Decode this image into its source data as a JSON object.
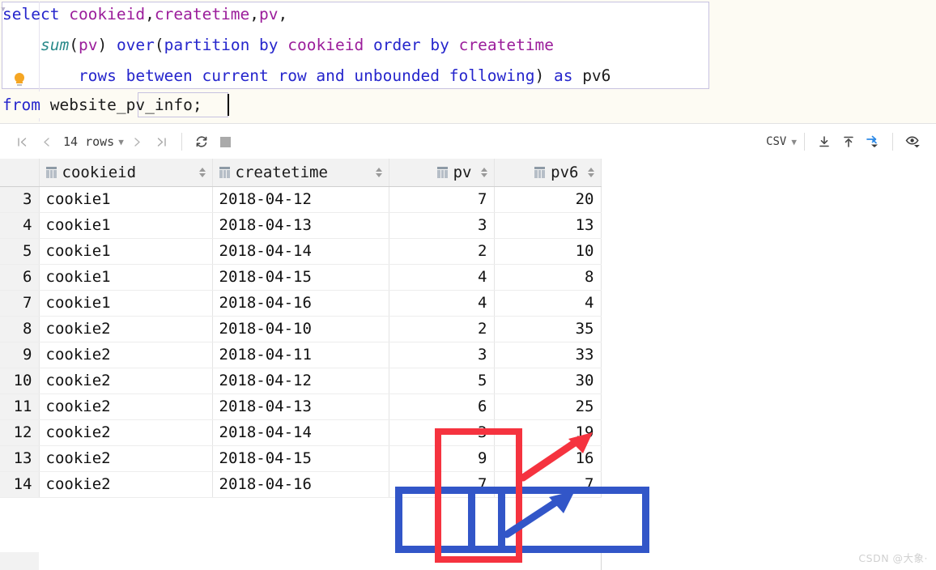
{
  "editor": {
    "lines": [
      {
        "indent": 0,
        "tokens": [
          {
            "t": "select",
            "c": "kw"
          },
          {
            "t": " ",
            "c": "plain"
          },
          {
            "t": "cookieid",
            "c": "ident"
          },
          {
            "t": ",",
            "c": "punct"
          },
          {
            "t": "createtime",
            "c": "ident"
          },
          {
            "t": ",",
            "c": "punct"
          },
          {
            "t": "pv",
            "c": "ident"
          },
          {
            "t": ",",
            "c": "punct"
          }
        ]
      },
      {
        "indent": 4,
        "tokens": [
          {
            "t": "sum",
            "c": "fn"
          },
          {
            "t": "(",
            "c": "punct"
          },
          {
            "t": "pv",
            "c": "ident"
          },
          {
            "t": ")",
            "c": "punct"
          },
          {
            "t": " ",
            "c": "plain"
          },
          {
            "t": "over",
            "c": "kw"
          },
          {
            "t": "(",
            "c": "punct"
          },
          {
            "t": "partition by",
            "c": "kw"
          },
          {
            "t": " ",
            "c": "plain"
          },
          {
            "t": "cookieid",
            "c": "ident"
          },
          {
            "t": " ",
            "c": "plain"
          },
          {
            "t": "order by",
            "c": "kw"
          },
          {
            "t": " ",
            "c": "plain"
          },
          {
            "t": "createtime",
            "c": "ident"
          }
        ]
      },
      {
        "indent": 8,
        "tokens": [
          {
            "t": "rows between current row and unbounded following",
            "c": "kw"
          },
          {
            "t": ")",
            "c": "punct"
          },
          {
            "t": " ",
            "c": "plain"
          },
          {
            "t": "as",
            "c": "kw"
          },
          {
            "t": " ",
            "c": "plain"
          },
          {
            "t": "pv6",
            "c": "plain"
          }
        ]
      },
      {
        "indent": 0,
        "tokens": [
          {
            "t": "from",
            "c": "kw"
          },
          {
            "t": " ",
            "c": "plain"
          },
          {
            "t": "website_pv_info",
            "c": "plain"
          },
          {
            "t": ";",
            "c": "punct"
          }
        ]
      }
    ],
    "full_sql": "select cookieid,createtime,pv,\n    sum(pv) over(partition by cookieid order by createtime\n        rows between current row and unbounded following) as pv6\nfrom website_pv_info;",
    "bulb_icon": "lightbulb-icon"
  },
  "toolbar": {
    "first_page_icon": "first-page-icon",
    "prev_page_icon": "prev-page-icon",
    "rows_label": "14 rows",
    "rows_chevron": "chevron-down-icon",
    "next_page_icon": "next-page-icon",
    "last_page_icon": "last-page-icon",
    "reload_icon": "refresh-icon",
    "stop_icon": "stop-icon",
    "format_label": "CSV",
    "format_chevron": "chevron-down-icon",
    "download_icon": "download-icon",
    "upload_icon": "upload-icon",
    "compare_icon": "transpose-icon",
    "view_icon": "eye-icon"
  },
  "table": {
    "columns": [
      {
        "key": "rownum",
        "label": "",
        "icon": "",
        "sortable": false
      },
      {
        "key": "cookieid",
        "label": "cookieid",
        "icon": "column-icon",
        "sortable": true
      },
      {
        "key": "createtime",
        "label": "createtime",
        "icon": "column-icon",
        "sortable": true
      },
      {
        "key": "pv",
        "label": "pv",
        "icon": "column-icon",
        "sortable": true
      },
      {
        "key": "pv6",
        "label": "pv6",
        "icon": "column-icon",
        "sortable": true
      }
    ],
    "rows": [
      {
        "n": "3",
        "cookieid": "cookie1",
        "createtime": "2018-04-12",
        "pv": "7",
        "pv6": "20"
      },
      {
        "n": "4",
        "cookieid": "cookie1",
        "createtime": "2018-04-13",
        "pv": "3",
        "pv6": "13"
      },
      {
        "n": "5",
        "cookieid": "cookie1",
        "createtime": "2018-04-14",
        "pv": "2",
        "pv6": "10"
      },
      {
        "n": "6",
        "cookieid": "cookie1",
        "createtime": "2018-04-15",
        "pv": "4",
        "pv6": "8"
      },
      {
        "n": "7",
        "cookieid": "cookie1",
        "createtime": "2018-04-16",
        "pv": "4",
        "pv6": "4"
      },
      {
        "n": "8",
        "cookieid": "cookie2",
        "createtime": "2018-04-10",
        "pv": "2",
        "pv6": "35"
      },
      {
        "n": "9",
        "cookieid": "cookie2",
        "createtime": "2018-04-11",
        "pv": "3",
        "pv6": "33"
      },
      {
        "n": "10",
        "cookieid": "cookie2",
        "createtime": "2018-04-12",
        "pv": "5",
        "pv6": "30"
      },
      {
        "n": "11",
        "cookieid": "cookie2",
        "createtime": "2018-04-13",
        "pv": "6",
        "pv6": "25"
      },
      {
        "n": "12",
        "cookieid": "cookie2",
        "createtime": "2018-04-14",
        "pv": "3",
        "pv6": "19"
      },
      {
        "n": "13",
        "cookieid": "cookie2",
        "createtime": "2018-04-15",
        "pv": "9",
        "pv6": "16"
      },
      {
        "n": "14",
        "cookieid": "cookie2",
        "createtime": "2018-04-16",
        "pv": "7",
        "pv6": "7"
      }
    ]
  },
  "annotations": {
    "red_box_color": "#f5333f",
    "blue_box_color": "#3256c8",
    "red_arrow": "red-arrow-icon",
    "blue_arrow": "blue-arrow-icon"
  },
  "watermark": {
    "text": "CSDN @大象·"
  }
}
